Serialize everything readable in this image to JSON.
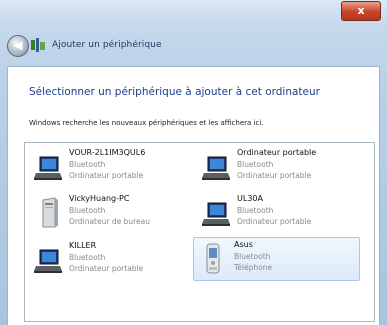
{
  "window": {
    "close_label": "x",
    "title": "Ajouter un périphérique"
  },
  "heading": "Sélectionner un périphérique à ajouter à cet ordinateur",
  "subtext": "Windows recherche les nouveaux périphériques et les affichera ici.",
  "devices": [
    {
      "name": "VOUR-2L1IM3QUL6",
      "line1": "Bluetooth",
      "line2": "Ordinateur portable",
      "icon": "laptop-icon"
    },
    {
      "name": "VickyHuang-PC",
      "line1": "Bluetooth",
      "line2": "Ordinateur de bureau",
      "icon": "desktop-tower-icon"
    },
    {
      "name": "KILLER",
      "line1": "Bluetooth",
      "line2": "Ordinateur portable",
      "icon": "laptop-icon"
    },
    {
      "name": "Ordinateur portable",
      "line1": "Bluetooth",
      "line2": "Ordinateur portable",
      "icon": "laptop-icon"
    },
    {
      "name": "UL30A",
      "line1": "Bluetooth",
      "line2": "Ordinateur portable",
      "icon": "laptop-icon"
    },
    {
      "name": "Asus",
      "line1": "Bluetooth",
      "line2": "Téléphone",
      "icon": "phone-icon"
    }
  ]
}
